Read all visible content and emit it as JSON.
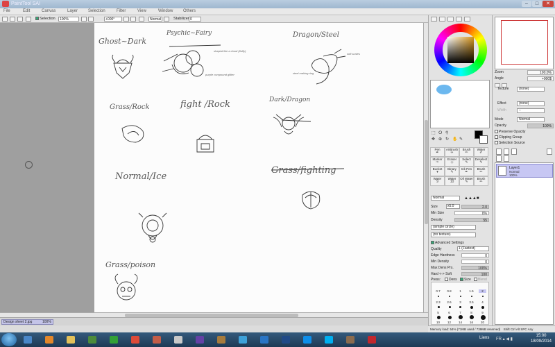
{
  "window": {
    "title": "PaintTool SAI",
    "min": "–",
    "max": "□",
    "close": "✕"
  },
  "menu": [
    "File",
    "Edit",
    "Canvas",
    "Layer",
    "Selection",
    "Filter",
    "View",
    "Window",
    "Others"
  ],
  "toolbar": {
    "selection_label": "Selection",
    "zoom": "100%",
    "angle": "+000°",
    "mode": "Normal",
    "stabilizer_label": "Stabilizer",
    "stabilizer_value": "0"
  },
  "canvas": {
    "labels": {
      "ghost_dark": "Ghost~Dark",
      "psychic_fairy": "Psychic~Fairy",
      "dragon_steel": "Dragon/Steel",
      "grass_rock": "Grass/Rock",
      "fight_rock": "fight /Rock",
      "dark_dragon": "Dark/Dragon",
      "normal_ice": "Normal/Ice",
      "grass_fighting": "Grass/fighting",
      "grass_poison": "Grass/poison"
    },
    "notes": {
      "psychic_1": "shaped like a cloud (fluffy)",
      "psychic_2": "purple compound glitter",
      "dragon_1": "soft scales",
      "dragon_2": "steel making ring"
    }
  },
  "file_tab": {
    "name": "Design sheet 2.jpg",
    "zoom": "100%"
  },
  "brushes": [
    {
      "name": "Pen",
      "icon": "pen-icon"
    },
    {
      "name": "AirBrush",
      "icon": "airbrush-icon"
    },
    {
      "name": "Brush",
      "icon": "brush-icon"
    },
    {
      "name": "Water",
      "icon": "water-icon"
    },
    {
      "name": "Marker",
      "icon": "marker-icon"
    },
    {
      "name": "Eraser",
      "icon": "eraser-icon"
    },
    {
      "name": "Select",
      "icon": "select-icon"
    },
    {
      "name": "Deselect",
      "icon": "deselect-icon"
    },
    {
      "name": "Bucket",
      "icon": "bucket-icon"
    },
    {
      "name": "Binary",
      "icon": "binary-icon"
    },
    {
      "name": "Ink Pen",
      "icon": "inkpen-icon"
    },
    {
      "name": "Brush",
      "icon": "brush-icon"
    },
    {
      "name": "Water",
      "icon": "water-icon"
    },
    {
      "name": "Water",
      "icon": "water-icon"
    },
    {
      "name": "Oil Water",
      "icon": "oilwater-icon"
    },
    {
      "name": "Brush",
      "icon": "brush-icon"
    }
  ],
  "brush_settings": {
    "mode": "Normal",
    "size_label": "Size",
    "size_mult": "x5.0",
    "size_value": "2.0",
    "minsize_label": "Min Size",
    "minsize_value": "0%",
    "density_label": "Density",
    "density_value": "55",
    "shape": "(simple circle)",
    "texture": "(no texture)",
    "advanced_label": "Advanced Settings",
    "quality_label": "Quality",
    "quality_value": "1 (Fastest)",
    "edge_label": "Edge Hardness",
    "edge_value": "0",
    "mindensity_label": "Min Density",
    "mindensity_value": "0",
    "maxdens_label": "Max Dens Prs.",
    "maxdens_value": "100%",
    "hardsoft_label": "Hard <-> Soft",
    "hardsoft_value": "100",
    "press_label": "Press:",
    "press_dens": "Dens",
    "press_size": "Size",
    "press_blend": "Blend"
  },
  "sizes": {
    "row1": [
      "0.7",
      "0.8",
      "1",
      "1.5",
      "2"
    ],
    "row2": [
      "2.3",
      "2.6",
      "3",
      "3.5",
      "4"
    ],
    "row3": [
      "5",
      "6",
      "7",
      "8",
      "9"
    ],
    "row4": [
      "10",
      "12",
      "14",
      "16",
      "20"
    ]
  },
  "status": "Memory load: 54% (71MB used / 739MB reserved)",
  "status_keys": "Shift Ctrl Alt SPC Any",
  "navigator": {
    "zoom_label": "Zoom",
    "zoom_value": "100.0%",
    "angle_label": "Angle",
    "angle_value": "+000$"
  },
  "layer_props": {
    "texture_label": "Texture",
    "texture_value": "(none)",
    "effect_label": "Effect",
    "effect_value": "(none)",
    "width_label": "Width",
    "width_value": "1",
    "mode_label": "Mode",
    "mode_value": "Normal",
    "opacity_label": "Opacity",
    "opacity_value": "100%",
    "preserve_opacity": "Preserve Opacity",
    "clipping_group": "Clipping Group",
    "selection_source": "Selection Source"
  },
  "layer": {
    "name": "Layer1",
    "mode": "Normal",
    "opacity": "100%"
  },
  "taskbar": {
    "lang": "Liens",
    "tray": "FR ▴ ◀ ▮",
    "time": "15:00",
    "date": "18/09/2014",
    "apps": [
      {
        "name": "explorer-icon",
        "color": "#4a87c8"
      },
      {
        "name": "media-player-icon",
        "color": "#e3872a"
      },
      {
        "name": "folder-icon",
        "color": "#e3c15a"
      },
      {
        "name": "minecraft-icon",
        "color": "#4d8b3b"
      },
      {
        "name": "green-app-icon",
        "color": "#33a036"
      },
      {
        "name": "chrome-icon",
        "color": "#dd4b39"
      },
      {
        "name": "sai-icon",
        "color": "#c35d48"
      },
      {
        "name": "book-icon",
        "color": "#c9c9c9"
      },
      {
        "name": "twitch-icon",
        "color": "#6441a5"
      },
      {
        "name": "game-icon",
        "color": "#a67b3d"
      },
      {
        "name": "dolphin-icon",
        "color": "#3ea1d9"
      },
      {
        "name": "network-icon",
        "color": "#2a75c5"
      },
      {
        "name": "eye-icon",
        "color": "#204a87"
      },
      {
        "name": "teamviewer-icon",
        "color": "#0e8ee9"
      },
      {
        "name": "skype-icon",
        "color": "#00aff0"
      },
      {
        "name": "gimp-icon",
        "color": "#8a6b4e"
      },
      {
        "name": "flash-icon",
        "color": "#c1272d"
      }
    ]
  }
}
